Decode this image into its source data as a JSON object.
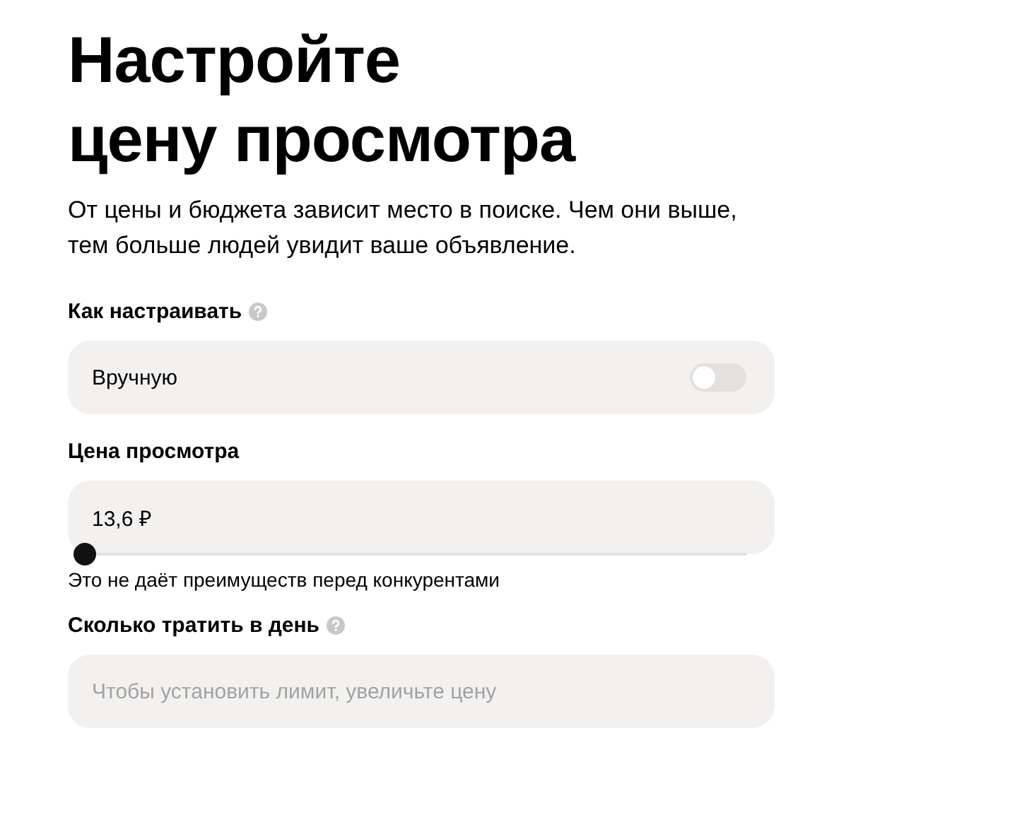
{
  "title_lines": [
    "Настройте",
    "цену просмотра"
  ],
  "description": "От цены и бюджета зависит место в поиске. Чем они выше, тем больше людей увидит ваше объявление.",
  "mode": {
    "label": "Как настраивать",
    "option": "Вручную",
    "on": false
  },
  "price": {
    "label": "Цена просмотра",
    "value": "13,6 ₽",
    "level": 0,
    "hint": "Это не даёт преимуществ перед конкурентами"
  },
  "daily": {
    "label": "Сколько тратить в день",
    "placeholder": "Чтобы установить лимит, увеличьте цену"
  }
}
